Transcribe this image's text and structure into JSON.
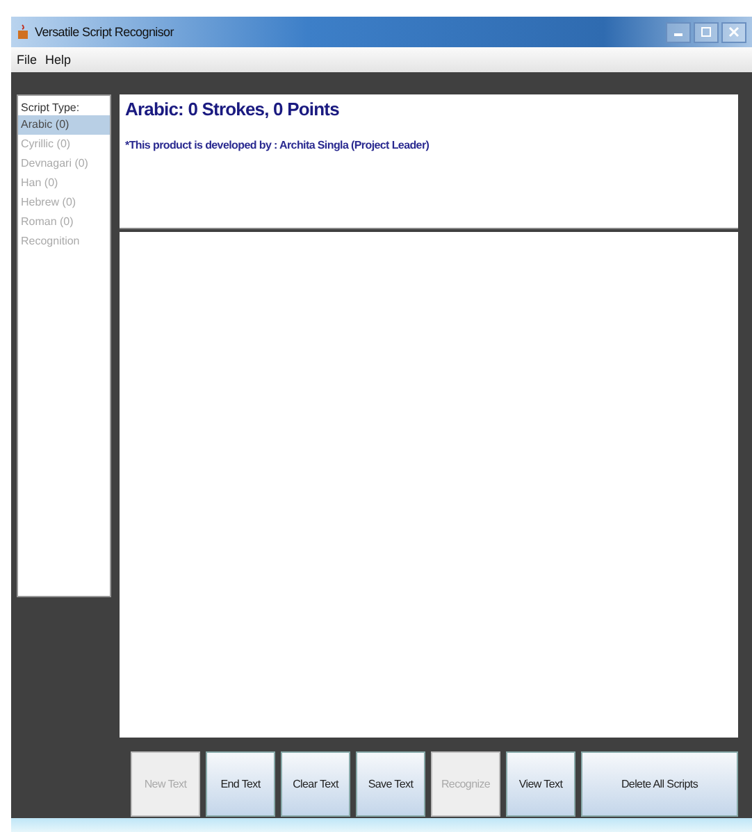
{
  "window": {
    "title": "Versatile Script Recognisor"
  },
  "menu": [
    "File",
    "Help"
  ],
  "sidebar": {
    "heading": "Script Type:",
    "items": [
      {
        "label": "Arabic (0)",
        "selected": true
      },
      {
        "label": "Cyrillic (0)",
        "selected": false
      },
      {
        "label": "Devnagari (0)",
        "selected": false
      },
      {
        "label": "Han (0)",
        "selected": false
      },
      {
        "label": "Hebrew (0)",
        "selected": false
      },
      {
        "label": "Roman (0)",
        "selected": false
      },
      {
        "label": "Recognition",
        "selected": false
      }
    ]
  },
  "header": {
    "title": "Arabic: 0 Strokes, 0 Points",
    "credit": "*This product is developed by : Archita Singla (Project Leader)"
  },
  "buttons": [
    {
      "label": "New Text",
      "disabled": true
    },
    {
      "label": "End Text",
      "disabled": false
    },
    {
      "label": "Clear Text",
      "disabled": false
    },
    {
      "label": "Save Text",
      "disabled": false
    },
    {
      "label": "Recognize",
      "disabled": true
    },
    {
      "label": "View Text",
      "disabled": false
    },
    {
      "label": "Delete All Scripts",
      "disabled": false
    }
  ]
}
